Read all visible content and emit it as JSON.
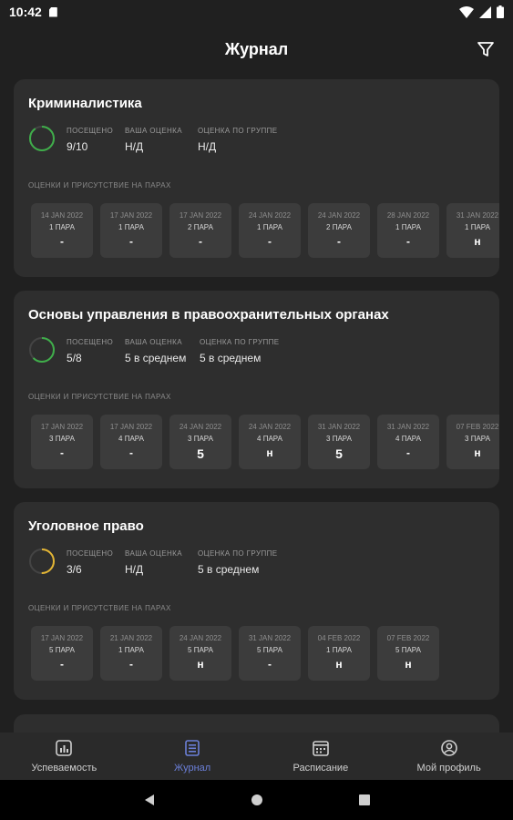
{
  "status": {
    "time": "10:42"
  },
  "app": {
    "title": "Журнал"
  },
  "colors": {
    "ring_green": "#3fae4a",
    "ring_yellow": "#e3b534",
    "active_nav": "#6b7fd8"
  },
  "cards": [
    {
      "title": "Криминалистика",
      "attendance_fraction": 0.9,
      "ring_color": "green",
      "stats": [
        {
          "label": "ПОСЕЩЕНО",
          "value": "9/10"
        },
        {
          "label": "ВАША ОЦЕНКА",
          "value": "Н/Д"
        },
        {
          "label": "ОЦЕНКА ПО ГРУППЕ",
          "value": "Н/Д"
        }
      ],
      "section_label": "ОЦЕНКИ И ПРИСУТСТВИЕ НА ПАРАХ",
      "tiles": [
        {
          "date": "14 JAN 2022",
          "pair": "1 ПАРА",
          "grade": "-"
        },
        {
          "date": "17 JAN 2022",
          "pair": "1 ПАРА",
          "grade": "-"
        },
        {
          "date": "17 JAN 2022",
          "pair": "2 ПАРА",
          "grade": "-"
        },
        {
          "date": "24 JAN 2022",
          "pair": "1 ПАРА",
          "grade": "-"
        },
        {
          "date": "24 JAN 2022",
          "pair": "2 ПАРА",
          "grade": "-"
        },
        {
          "date": "28 JAN 2022",
          "pair": "1 ПАРА",
          "grade": "-"
        },
        {
          "date": "31 JAN 2022",
          "pair": "1 ПАРА",
          "grade": "н"
        }
      ]
    },
    {
      "title": "Основы управления в правоохранительных органах",
      "attendance_fraction": 0.625,
      "ring_color": "green",
      "stats": [
        {
          "label": "ПОСЕЩЕНО",
          "value": "5/8"
        },
        {
          "label": "ВАША ОЦЕНКА",
          "value": "5 в среднем"
        },
        {
          "label": "ОЦЕНКА ПО ГРУППЕ",
          "value": "5 в среднем"
        }
      ],
      "section_label": "ОЦЕНКИ И ПРИСУТСТВИЕ НА ПАРАХ",
      "tiles": [
        {
          "date": "17 JAN 2022",
          "pair": "3 ПАРА",
          "grade": "-"
        },
        {
          "date": "17 JAN 2022",
          "pair": "4 ПАРА",
          "grade": "-"
        },
        {
          "date": "24 JAN 2022",
          "pair": "3 ПАРА",
          "grade": "5"
        },
        {
          "date": "24 JAN 2022",
          "pair": "4 ПАРА",
          "grade": "н"
        },
        {
          "date": "31 JAN 2022",
          "pair": "3 ПАРА",
          "grade": "5"
        },
        {
          "date": "31 JAN 2022",
          "pair": "4 ПАРА",
          "grade": "-"
        },
        {
          "date": "07 FEB 2022",
          "pair": "3 ПАРА",
          "grade": "н"
        }
      ]
    },
    {
      "title": "Уголовное право",
      "attendance_fraction": 0.5,
      "ring_color": "yellow",
      "stats": [
        {
          "label": "ПОСЕЩЕНО",
          "value": "3/6"
        },
        {
          "label": "ВАША ОЦЕНКА",
          "value": "Н/Д"
        },
        {
          "label": "ОЦЕНКА ПО ГРУППЕ",
          "value": "5 в среднем"
        }
      ],
      "section_label": "ОЦЕНКИ И ПРИСУТСТВИЕ НА ПАРАХ",
      "tiles": [
        {
          "date": "17 JAN 2022",
          "pair": "5 ПАРА",
          "grade": "-"
        },
        {
          "date": "21 JAN 2022",
          "pair": "1 ПАРА",
          "grade": "-"
        },
        {
          "date": "24 JAN 2022",
          "pair": "5 ПАРА",
          "grade": "н"
        },
        {
          "date": "31 JAN 2022",
          "pair": "5 ПАРА",
          "grade": "-"
        },
        {
          "date": "04 FEB 2022",
          "pair": "1 ПАРА",
          "grade": "н"
        },
        {
          "date": "07 FEB 2022",
          "pair": "5 ПАРА",
          "grade": "н"
        }
      ]
    }
  ],
  "nav": [
    {
      "label": "Успеваемость",
      "icon": "chart-icon",
      "active": false
    },
    {
      "label": "Журнал",
      "icon": "journal-icon",
      "active": true
    },
    {
      "label": "Расписание",
      "icon": "calendar-icon",
      "active": false
    },
    {
      "label": "Мой профиль",
      "icon": "profile-icon",
      "active": false
    }
  ]
}
